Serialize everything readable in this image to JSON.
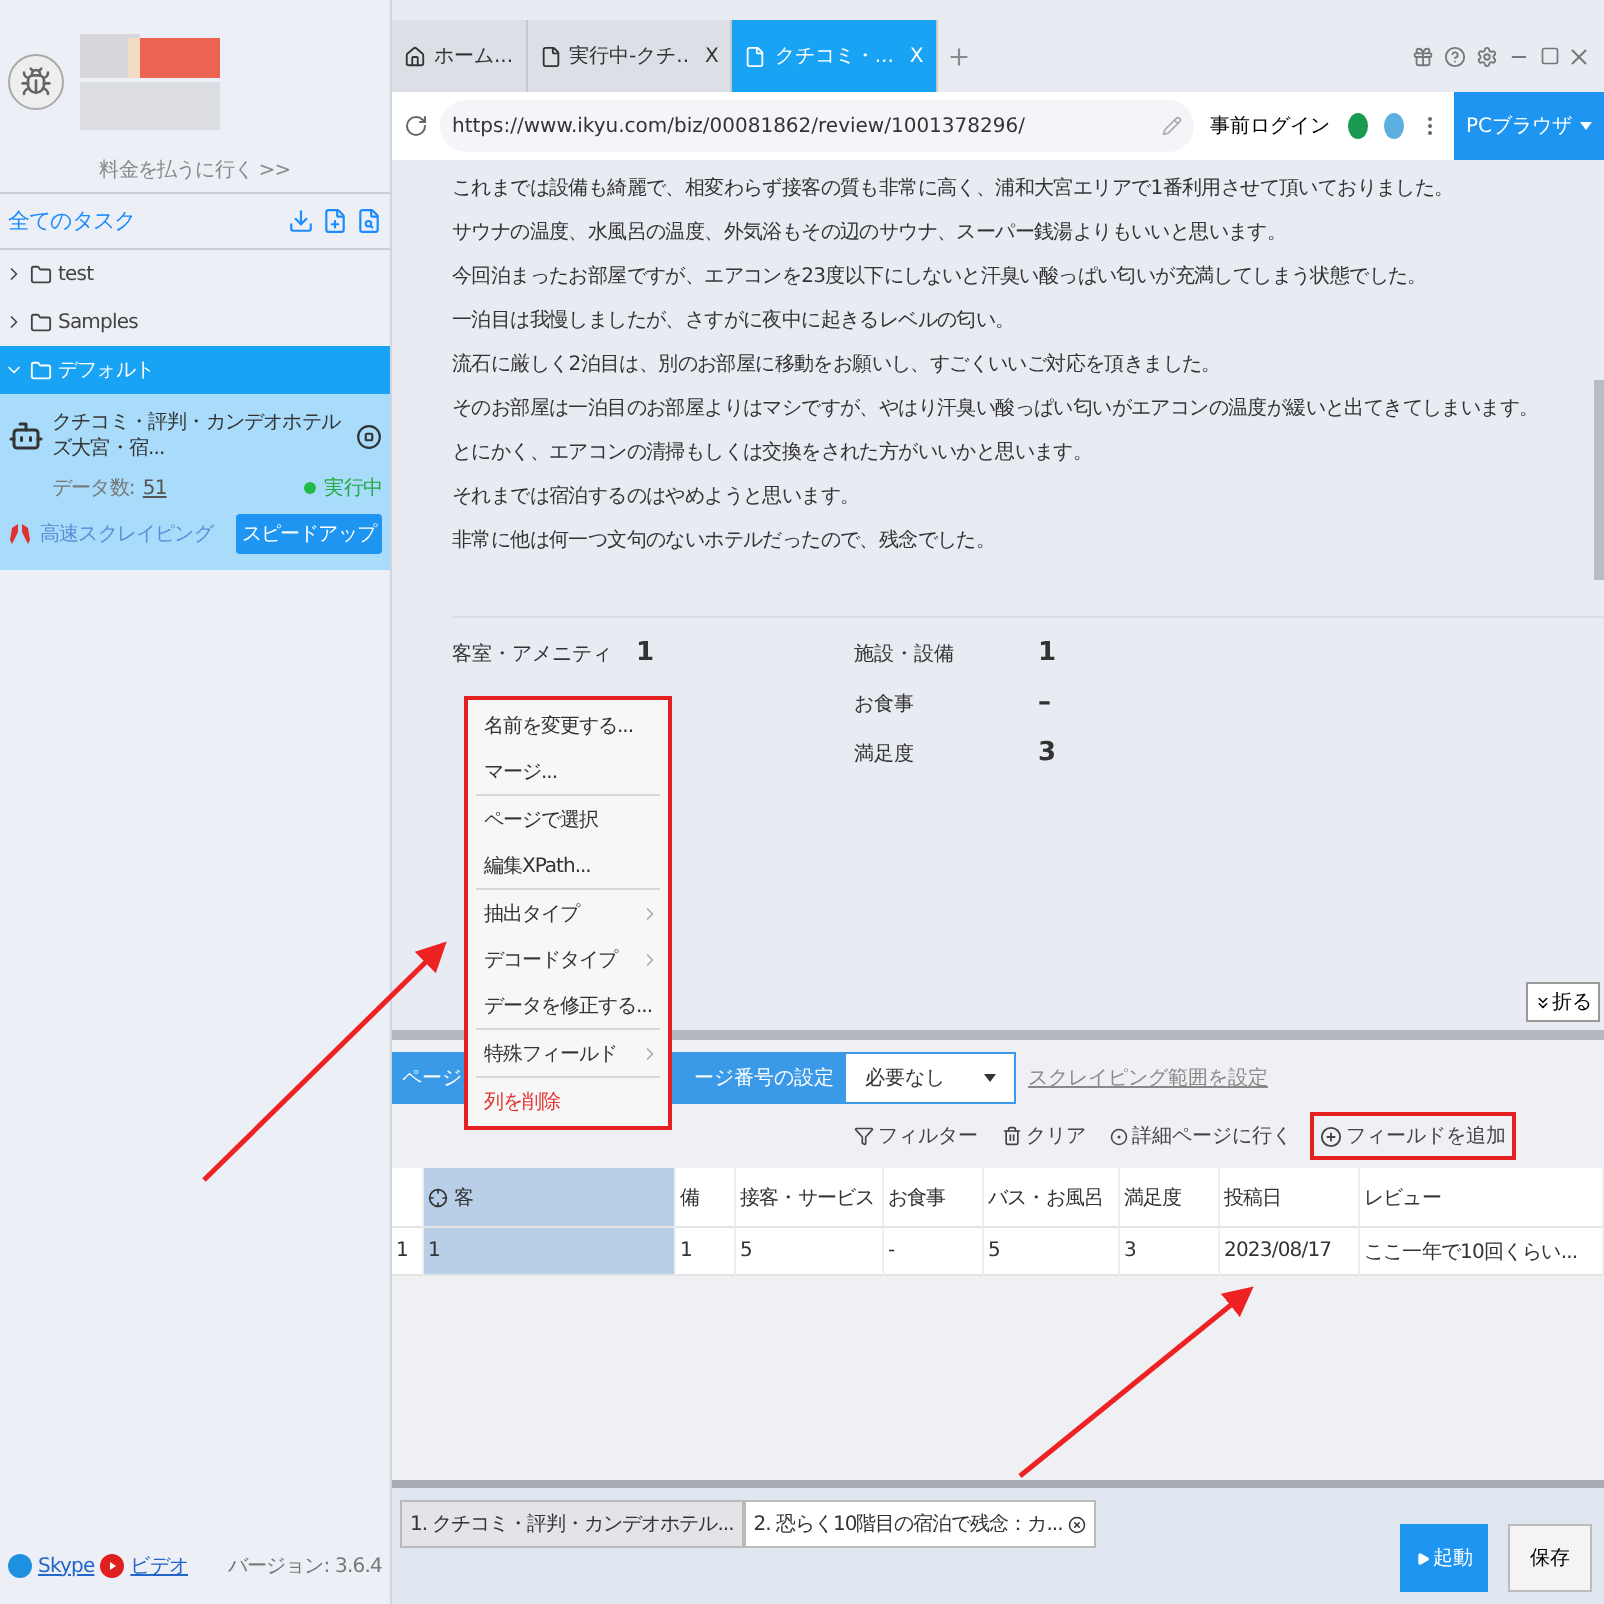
{
  "sidebar": {
    "pay_link": "料金を払うに行く >>",
    "all_tasks": "全てのタスク",
    "tree": [
      {
        "label": "test",
        "expanded": false,
        "selected": false
      },
      {
        "label": "Samples",
        "expanded": false,
        "selected": false
      },
      {
        "label": "デフォルト",
        "expanded": true,
        "selected": true
      }
    ],
    "task": {
      "name": "クチコミ・評判・カンデオホテルズ大宮・宿...",
      "count_label": "データ数:",
      "count": "51",
      "status": "実行中",
      "fast_label": "高速スクレイピング",
      "speed_button": "スピードアップ"
    },
    "links": [
      "Skype",
      "ビデオ"
    ],
    "version": "バージョン: 3.6.4"
  },
  "tabs": [
    {
      "label": "ホーム...",
      "kind": "home",
      "selected": false
    },
    {
      "label": "実行中-クチ..",
      "kind": "page",
      "close": "X",
      "selected": false
    },
    {
      "label": "クチコミ・...",
      "kind": "page",
      "close": "X",
      "selected": true
    }
  ],
  "address_bar": {
    "url": "https://www.ikyu.com/biz/00081862/review/1001378296/",
    "login": "事前ログイン",
    "browser_mode": "PCブラウザ"
  },
  "review_lines": [
    "これまでは設備も綺麗で、相変わらず接客の質も非常に高く、浦和大宮エリアで1番利用させて頂いておりました。",
    "サウナの温度、水風呂の温度、外気浴もその辺のサウナ、スーパー銭湯よりもいいと思います。",
    "今回泊まったお部屋ですが、エアコンを23度以下にしないと汗臭い酸っぱい匂いが充満してしまう状態でした。",
    "一泊目は我慢しましたが、さすがに夜中に起きるレベルの匂い。",
    "流石に厳しく2泊目は、別のお部屋に移動をお願いし、すごくいいご対応を頂きました。",
    "そのお部屋は一泊目のお部屋よりはマシですが、やはり汗臭い酸っぱい匂いがエアコンの温度が緩いと出てきてしまいます。",
    "とにかく、エアコンの清掃もしくは交換をされた方がいいかと思います。",
    "それまでは宿泊するのはやめようと思います。",
    "非常に他は何一つ文句のないホテルだったので、残念でした。"
  ],
  "ratings_left": [
    {
      "label": "客室・アメニティ",
      "value": "1"
    }
  ],
  "ratings_right": [
    {
      "label": "施設・設備",
      "value": "1"
    },
    {
      "label": "お食事",
      "value": "–"
    },
    {
      "label": "満足度",
      "value": "3"
    }
  ],
  "collapse_button": "折る",
  "context_menu": {
    "groups": [
      [
        {
          "label": "名前を変更する...",
          "kind": "item"
        },
        {
          "label": "マージ...",
          "kind": "item"
        }
      ],
      [
        {
          "label": "ページで選択",
          "kind": "item"
        },
        {
          "label": "編集XPath...",
          "kind": "item"
        }
      ],
      [
        {
          "label": "抽出タイプ",
          "kind": "submenu"
        },
        {
          "label": "デコードタイプ",
          "kind": "submenu"
        },
        {
          "label": "データを修正する...",
          "kind": "item"
        }
      ],
      [
        {
          "label": "特殊フィールド",
          "kind": "submenu"
        }
      ],
      [
        {
          "label": "列を削除",
          "kind": "danger"
        }
      ]
    ]
  },
  "toolbar": {
    "page_type": "ページ",
    "page_number": "ージ番号の設定",
    "select_value": "必要なし",
    "range_link": "スクレイピング範囲を設定",
    "filter": "フィルター",
    "clear": "クリア",
    "detail": "詳細ページに行く",
    "add_field": "フィールドを追加"
  },
  "table": {
    "columns": [
      {
        "label": "客",
        "selected": true
      },
      {
        "label": "備",
        "selected": false
      },
      {
        "label": "接客・サービス",
        "selected": false
      },
      {
        "label": "お食事",
        "selected": false
      },
      {
        "label": "バス・お風呂",
        "selected": false
      },
      {
        "label": "満足度",
        "selected": false
      },
      {
        "label": "投稿日",
        "selected": false
      },
      {
        "label": "レビュー",
        "selected": false
      }
    ],
    "rows": [
      {
        "index": "1",
        "cells": [
          "1",
          "1",
          "5",
          "-",
          "5",
          "3",
          "2023/08/17",
          "ここ一年で10回くらい..."
        ]
      }
    ]
  },
  "task_tabs": [
    {
      "label": "1. クチコミ・評判・カンデオホテル...",
      "selected": false
    },
    {
      "label": "2. 恐らく10階目の宿泊で残念：カ...",
      "selected": true
    }
  ],
  "buttons": {
    "start": "起動",
    "save": "保存"
  }
}
